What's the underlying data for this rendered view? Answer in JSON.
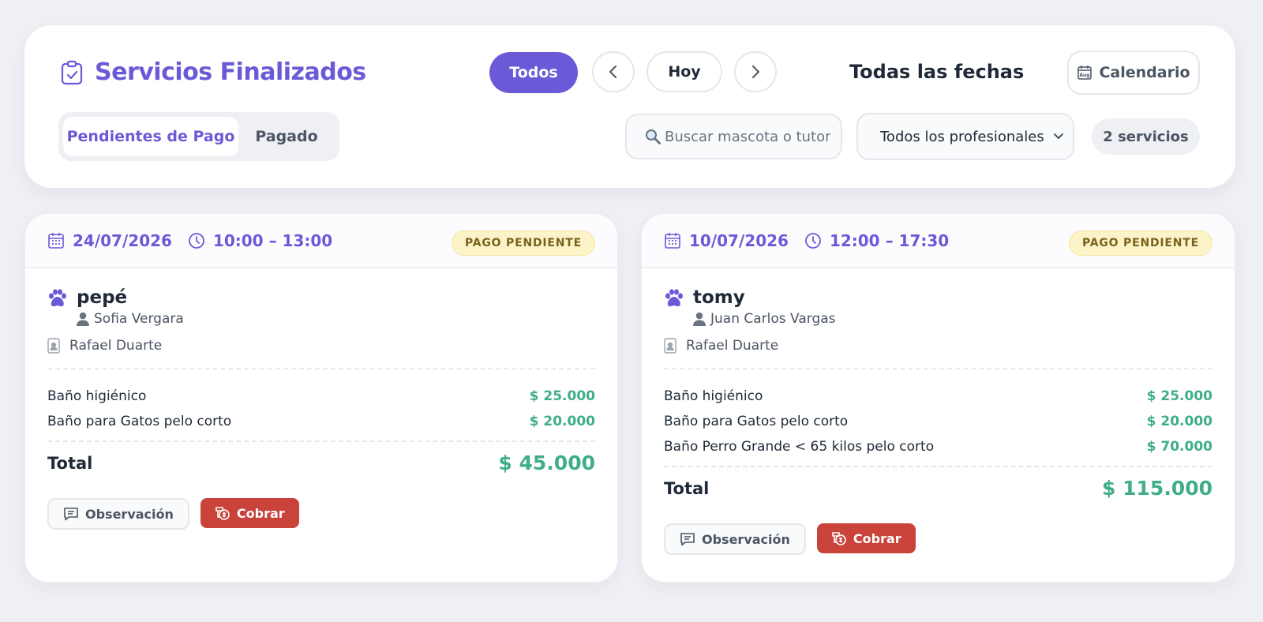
{
  "header": {
    "title": "Servicios Finalizados",
    "filter_all_label": "Todos",
    "today_label": "Hoy",
    "date_range_label": "Todas las fechas",
    "calendar_label": "Calendario",
    "calendar_icon_text": "Aug"
  },
  "tabs": [
    {
      "label": "Pendientes de Pago",
      "active": true
    },
    {
      "label": "Pagado",
      "active": false
    }
  ],
  "search": {
    "placeholder": "Buscar mascota o tutor",
    "value": ""
  },
  "professional_filter": {
    "selected": "Todos los profesionales"
  },
  "count_label": "2 servicios",
  "colors": {
    "accent": "#6a5ad8",
    "price": "#3fae85",
    "danger": "#c9433a",
    "pending_bg": "#fdf3c9"
  },
  "services": [
    {
      "date": "24/07/2026",
      "time": "10:00 – 13:00",
      "status": "PAGO PENDIENTE",
      "pet": "pepé",
      "tutor": "Sofia Vergara",
      "professional": "Rafael Duarte",
      "items": [
        {
          "name": "Baño higiénico",
          "price": "$ 25.000"
        },
        {
          "name": "Baño para Gatos pelo corto",
          "price": "$ 20.000"
        }
      ],
      "total_label": "Total",
      "total": "$ 45.000",
      "observation_label": "Observación",
      "charge_label": "Cobrar"
    },
    {
      "date": "10/07/2026",
      "time": "12:00 – 17:30",
      "status": "PAGO PENDIENTE",
      "pet": "tomy",
      "tutor": "Juan Carlos Vargas",
      "professional": "Rafael Duarte",
      "items": [
        {
          "name": "Baño higiénico",
          "price": "$ 25.000"
        },
        {
          "name": "Baño para Gatos pelo corto",
          "price": "$ 20.000"
        },
        {
          "name": "Baño Perro Grande < 65 kilos pelo corto",
          "price": "$ 70.000"
        }
      ],
      "total_label": "Total",
      "total": "$ 115.000",
      "observation_label": "Observación",
      "charge_label": "Cobrar"
    }
  ]
}
